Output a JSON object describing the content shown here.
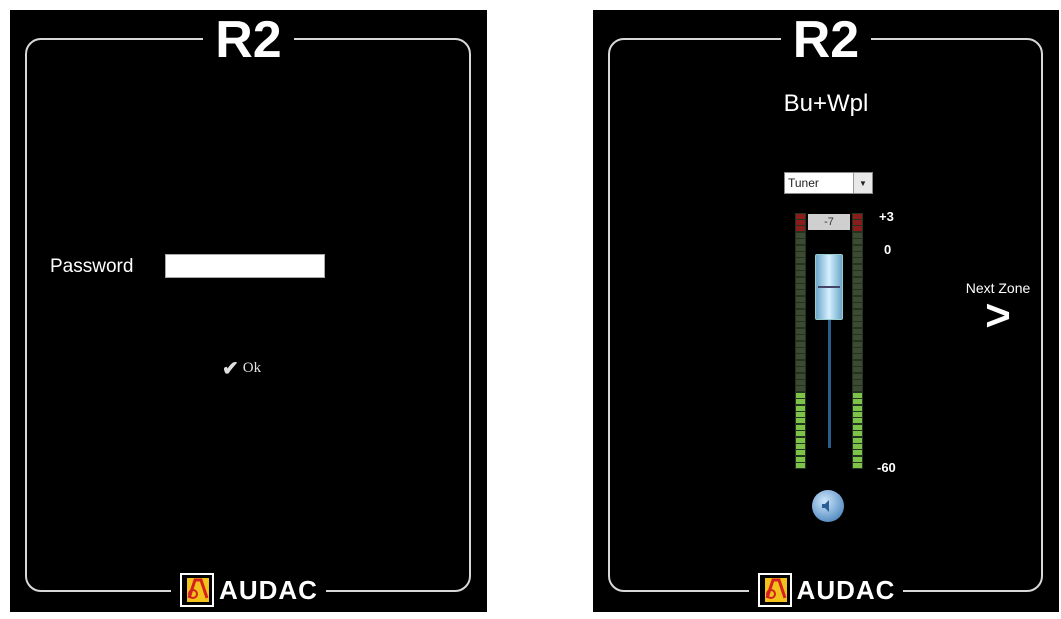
{
  "login_panel": {
    "title": "R2",
    "password_label": "Password",
    "password_value": "",
    "ok_label": "Ok",
    "logo_text": "AUDAC"
  },
  "zone_panel": {
    "title": "R2",
    "zone_name": "Bu+Wpl",
    "source_select": {
      "selected": "Tuner"
    },
    "volume_readout": "-7",
    "scale": {
      "top": "+3",
      "zero": "0",
      "bottom": "-60"
    },
    "meter_level_fraction": 0.29,
    "next_zone_label": "Next Zone",
    "next_zone_glyph": ">",
    "logo_text": "AUDAC"
  },
  "icons": {
    "ok": "checkmark-icon",
    "mute": "speaker-icon",
    "next": "chevron-right-icon",
    "logo": "audac-logo-icon"
  },
  "colors": {
    "panel_bg": "#000000",
    "text": "#ffffff",
    "meter_green": "#7fc24a",
    "meter_red": "#8a1c1c",
    "logo_yellow": "#f1c21b",
    "logo_red": "#d42020"
  }
}
